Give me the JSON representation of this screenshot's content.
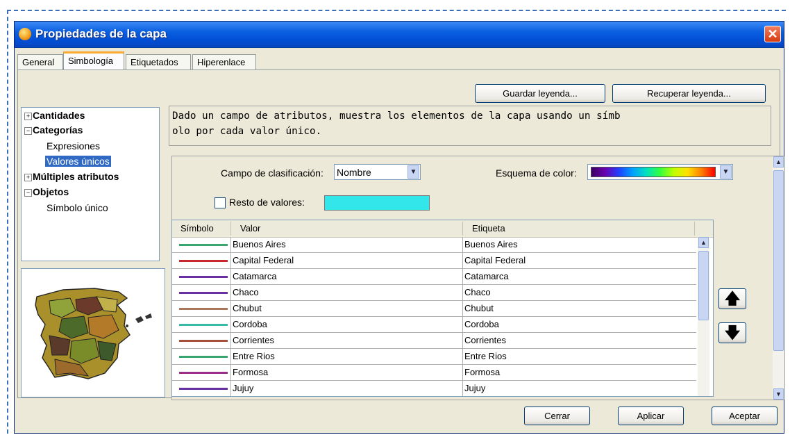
{
  "window": {
    "title": "Propiedades de la capa",
    "close_glyph": "✕"
  },
  "tabs": [
    {
      "label": "General"
    },
    {
      "label": "Simbología"
    },
    {
      "label": "Etiquetados"
    },
    {
      "label": "Hiperenlace"
    }
  ],
  "toolbar": {
    "save_legend": "Guardar leyenda...",
    "load_legend": "Recuperar leyenda..."
  },
  "tree": {
    "items": [
      {
        "label": "Cantidades"
      },
      {
        "label": "Categorías"
      },
      {
        "label": "Expresiones"
      },
      {
        "label": "Valores únicos"
      },
      {
        "label": "Múltiples atributos"
      },
      {
        "label": "Objetos"
      },
      {
        "label": "Símbolo único"
      }
    ]
  },
  "description": {
    "line1": "Dado un campo de atributos, muestra los elementos de la capa usando un símb",
    "line2": "olo por cada valor único."
  },
  "classification": {
    "field_label": "Campo de clasificación:",
    "field_value": "Nombre",
    "scheme_label": "Esquema de color:",
    "rest_label": "Resto de valores:",
    "rest_checked": false,
    "rest_color": "#33e6ea"
  },
  "table": {
    "headers": {
      "symbol": "Símbolo",
      "value": "Valor",
      "label": "Etiqueta"
    },
    "rows": [
      {
        "color": "#3aa66f",
        "value": "Buenos Aires",
        "label": "Buenos Aires"
      },
      {
        "color": "#c8272c",
        "value": "Capital Federal",
        "label": "Capital Federal"
      },
      {
        "color": "#6a2fa0",
        "value": "Catamarca",
        "label": "Catamarca"
      },
      {
        "color": "#6a2fa0",
        "value": "Chaco",
        "label": "Chaco"
      },
      {
        "color": "#a8765a",
        "value": "Chubut",
        "label": "Chubut"
      },
      {
        "color": "#3ab8a6",
        "value": "Cordoba",
        "label": "Cordoba"
      },
      {
        "color": "#a4503a",
        "value": "Corrientes",
        "label": "Corrientes"
      },
      {
        "color": "#3aa66f",
        "value": "Entre Rios",
        "label": "Entre Rios"
      },
      {
        "color": "#9a2f8a",
        "value": "Formosa",
        "label": "Formosa"
      },
      {
        "color": "#6a2fa0",
        "value": "Jujuy",
        "label": "Jujuy"
      }
    ]
  },
  "move": {
    "up_glyph": "🡅",
    "down_glyph": "🡇"
  },
  "footer": {
    "close": "Cerrar",
    "apply": "Aplicar",
    "accept": "Aceptar"
  }
}
